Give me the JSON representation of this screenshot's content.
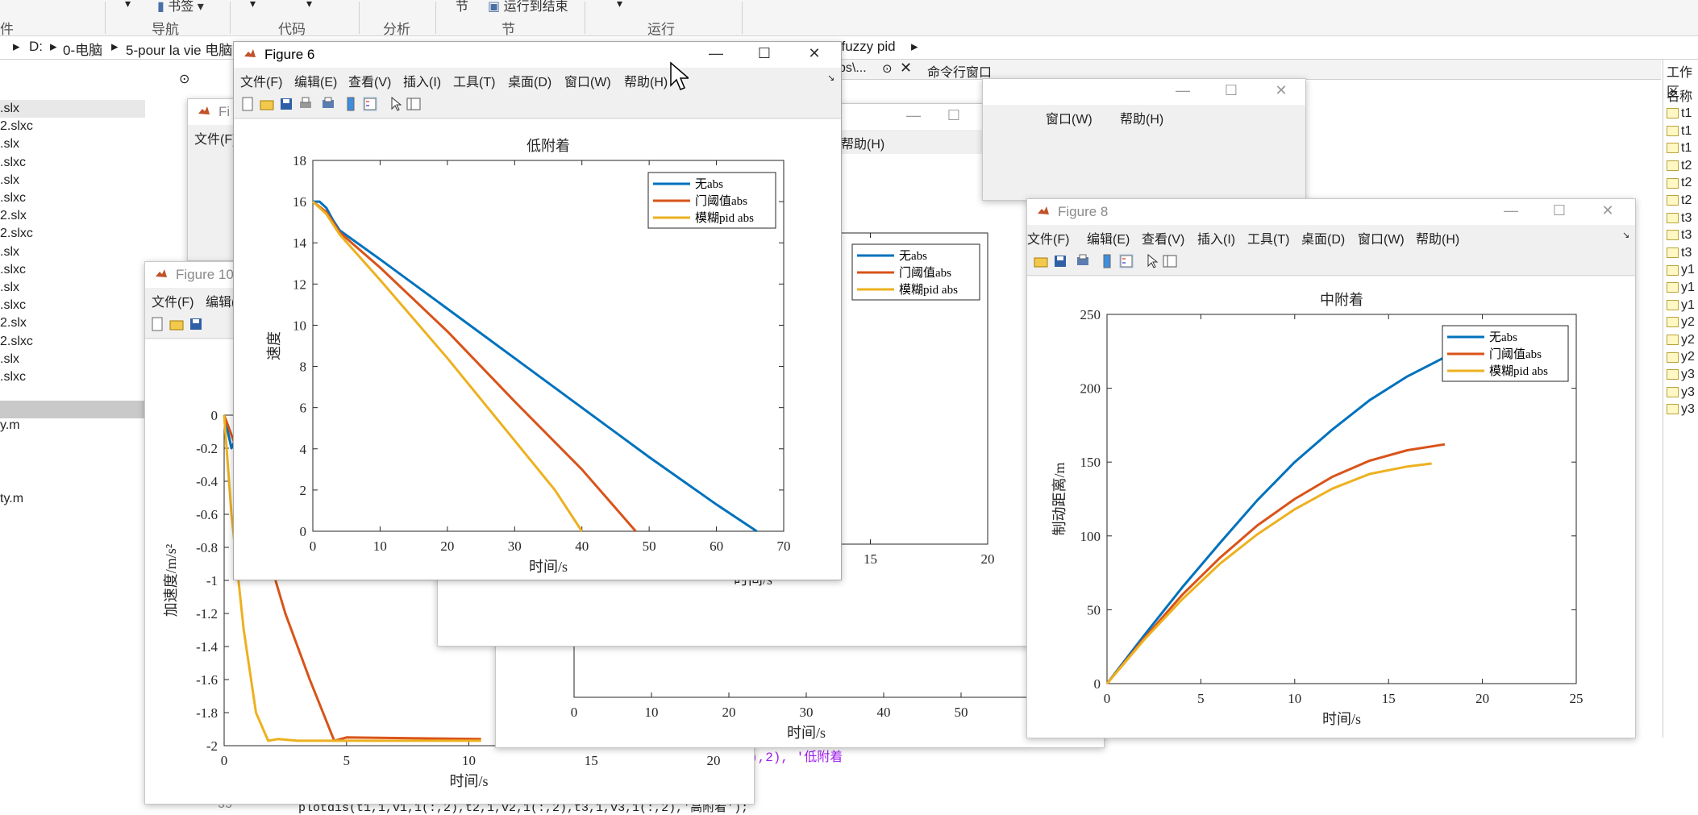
{
  "ribbon": {
    "groups": [
      "件",
      "导航",
      "代码",
      "分析",
      "节",
      "运行"
    ],
    "top_items": [
      "书签",
      "节",
      "运行到结束"
    ]
  },
  "address": {
    "drive": "D:",
    "path": [
      "0-电脑",
      "5-pour la vie 电脑"
    ],
    "folder_tail": "l fuzzy pid"
  },
  "file_browser": {
    "files": [
      ".slx",
      "2.slxc",
      ".slx",
      ".slxc",
      ".slx",
      ".slxc",
      "2.slx",
      "2.slxc",
      ".slx",
      ".slxc",
      ".slx",
      ".slxc",
      "2.slx",
      "2.slxc",
      ".slx",
      ".slxc"
    ],
    "mfiles": [
      "y.m",
      "ty.m"
    ]
  },
  "workspace": {
    "title": "工作区",
    "column": "名称",
    "vars": [
      "t1",
      "t1",
      "t1",
      "t2",
      "t2",
      "t2",
      "t3",
      "t3",
      "t3",
      "y1",
      "y1",
      "y1",
      "y2",
      "y2",
      "y2",
      "y3",
      "y3",
      "y3"
    ]
  },
  "editor": {
    "tab_fragment": "bs\\...",
    "command_window": "命令行窗口",
    "line_number": "35",
    "code_line": "plotdis(t1,1,v1,1(:,2),t2,1,v2,1(:,2),t3,1,v3,1(:,2),'高附着');",
    "code_frag": "),2), '低附着"
  },
  "menus": {
    "file": "文件(F)",
    "edit": "编辑(E)",
    "view": "查看(V)",
    "insert": "插入(I)",
    "tools": "工具(T)",
    "desktop": "桌面(D)",
    "window": "窗口(W)",
    "help": "帮助(H)"
  },
  "fig6": {
    "title": "Figure 6",
    "chart_data": {
      "type": "line",
      "title": "低附着",
      "xlabel": "时间/s",
      "ylabel": "速度",
      "xlim": [
        0,
        70
      ],
      "ylim": [
        0,
        18
      ],
      "xticks": [
        0,
        10,
        20,
        30,
        40,
        50,
        60,
        70
      ],
      "yticks": [
        0,
        2,
        4,
        6,
        8,
        10,
        12,
        14,
        16,
        18
      ],
      "legend_position": "top-right",
      "series": [
        {
          "name": "无abs",
          "color": "#0072BD",
          "x": [
            0,
            1,
            2,
            3,
            4,
            10,
            20,
            30,
            40,
            50,
            60,
            66
          ],
          "y": [
            16,
            16,
            15.7,
            15.1,
            14.6,
            13.2,
            10.8,
            8.4,
            6.0,
            3.6,
            1.3,
            0
          ]
        },
        {
          "name": "门阈值abs",
          "color": "#D95319",
          "x": [
            0,
            2,
            3,
            4,
            10,
            20,
            30,
            40,
            48
          ],
          "y": [
            16,
            15.5,
            15.0,
            14.5,
            12.8,
            9.7,
            6.3,
            3.0,
            0
          ]
        },
        {
          "name": "模糊pid abs",
          "color": "#EDB120",
          "x": [
            0,
            2,
            4,
            10,
            20,
            30,
            36,
            40
          ],
          "y": [
            16,
            15.4,
            14.4,
            12.2,
            8.4,
            4.4,
            2.0,
            0
          ]
        }
      ]
    }
  },
  "fig8": {
    "title": "Figure 8",
    "chart_data": {
      "type": "line",
      "title": "中附着",
      "xlabel": "时间/s",
      "ylabel": "制动距离/m",
      "xlim": [
        0,
        25
      ],
      "ylim": [
        0,
        250
      ],
      "xticks": [
        0,
        5,
        10,
        15,
        20,
        25
      ],
      "yticks": [
        0,
        50,
        100,
        150,
        200,
        250
      ],
      "legend_position": "top-right",
      "series": [
        {
          "name": "无abs",
          "color": "#0072BD",
          "x": [
            0,
            2,
            4,
            6,
            8,
            10,
            12,
            14,
            16,
            18
          ],
          "y": [
            0,
            33,
            65,
            95,
            124,
            150,
            172,
            192,
            208,
            221
          ]
        },
        {
          "name": "门阈值abs",
          "color": "#D95319",
          "x": [
            0,
            2,
            4,
            6,
            8,
            10,
            12,
            14,
            16,
            18
          ],
          "y": [
            0,
            31,
            60,
            85,
            107,
            125,
            140,
            151,
            158,
            162
          ]
        },
        {
          "name": "模糊pid abs",
          "color": "#EDB120",
          "x": [
            0,
            2,
            4,
            6,
            8,
            10,
            12,
            14,
            16,
            17.3
          ],
          "y": [
            0,
            30,
            57,
            81,
            101,
            118,
            132,
            142,
            147,
            149
          ]
        }
      ]
    }
  },
  "fig10": {
    "title": "Figure 10",
    "chart_data": {
      "type": "line",
      "xlabel": "时间/s",
      "ylabel": "加速度/m/s²",
      "xlim": [
        0,
        20
      ],
      "ylim": [
        -2,
        0
      ],
      "xticks": [
        0,
        5,
        10,
        15,
        20
      ],
      "yticks": [
        0,
        -0.2,
        -0.4,
        -0.6,
        -0.8,
        -1,
        -1.2,
        -1.4,
        -1.6,
        -1.8,
        -2
      ],
      "series": [
        {
          "color": "#0072BD",
          "x": [
            0,
            0.3,
            0.6
          ],
          "y": [
            0,
            -0.2,
            -0.1
          ]
        },
        {
          "color": "#D95319",
          "x": [
            0,
            0.5,
            1.5,
            2.5,
            3.5,
            4.5,
            5,
            10.5
          ],
          "y": [
            0,
            -0.2,
            -0.7,
            -1.2,
            -1.6,
            -1.97,
            -1.95,
            -1.96
          ]
        },
        {
          "color": "#EDB120",
          "x": [
            0,
            0.3,
            0.8,
            1.3,
            1.8,
            2.2,
            3,
            10.5
          ],
          "y": [
            0,
            -0.6,
            -1.3,
            -1.8,
            -1.97,
            -1.96,
            -1.97,
            -1.97
          ]
        }
      ]
    }
  },
  "figA": {
    "xticks": [
      0,
      5,
      10,
      15,
      20
    ],
    "chart_data": {
      "type": "line",
      "xlabel": "时间/s",
      "xlim": [
        0,
        20
      ],
      "legend_position": "top-right",
      "series": [
        {
          "name": "无abs",
          "color": "#0072BD"
        },
        {
          "name": "门阈值abs",
          "color": "#D95319"
        },
        {
          "name": "模糊pid abs",
          "color": "#EDB120"
        }
      ]
    }
  },
  "figB": {
    "chart_data": {
      "type": "line",
      "xlabel": "时间/s",
      "xlim": [
        0,
        60
      ],
      "xticks": [
        0,
        10,
        20,
        30,
        40,
        50,
        60
      ]
    }
  }
}
